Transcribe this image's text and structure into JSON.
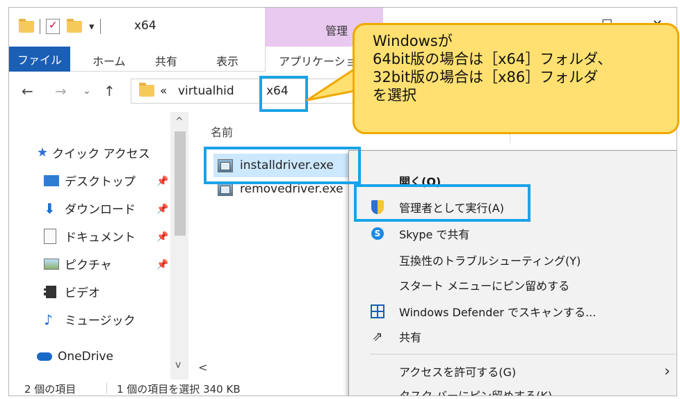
{
  "window": {
    "title": "x64",
    "manage_tab": "管理",
    "maximize_glyph": "☐",
    "close_glyph": "✕"
  },
  "ribbon": {
    "file": "ファイル",
    "home": "ホーム",
    "share": "共有",
    "view": "表示",
    "app_tools": "アプリケーション"
  },
  "address": {
    "prefix": "«",
    "segment1": "virtualhid",
    "segment2": "x64"
  },
  "nav": {
    "quick_access": "クイック アクセス",
    "items": [
      {
        "label": "デスクトップ",
        "icon": "desktop-icon"
      },
      {
        "label": "ダウンロード",
        "icon": "download-icon"
      },
      {
        "label": "ドキュメント",
        "icon": "document-icon"
      },
      {
        "label": "ピクチャ",
        "icon": "picture-icon"
      },
      {
        "label": "ビデオ",
        "icon": "video-icon"
      },
      {
        "label": "ミュージック",
        "icon": "music-icon"
      },
      {
        "label": "OneDrive",
        "icon": "cloud-icon"
      }
    ]
  },
  "files": {
    "column_name": "名前",
    "rows": [
      {
        "name": "installdriver.exe",
        "selected": true
      },
      {
        "name": "removedriver.exe",
        "selected": false
      }
    ]
  },
  "status": {
    "count": "2 個の項目",
    "selection": "1 個の項目を選択 340 KB"
  },
  "context_menu": {
    "items": [
      {
        "label": "開く(O)"
      },
      {
        "label": "管理者として実行(A)",
        "icon": "uac-shield-icon"
      },
      {
        "label": "Skype で共有",
        "icon": "skype-icon"
      },
      {
        "label": "互換性のトラブルシューティング(Y)"
      },
      {
        "label": "スタート メニューにピン留めする"
      },
      {
        "label": "Windows Defender でスキャンする...",
        "icon": "defender-icon"
      },
      {
        "label": "共有",
        "icon": "share-icon"
      },
      {
        "label": "アクセスを許可する(G)",
        "submenu": true
      },
      {
        "label": "タスク バーにピン留めする(K)"
      }
    ]
  },
  "callout": {
    "line1": "Windowsが",
    "line2": "64bit版の場合は［x64］フォルダ、",
    "line3": "32bit版の場合は［x86］フォルダ",
    "line4": "を選択"
  },
  "colors": {
    "highlight": "#1aa3e8",
    "callout_fill": "#ffe070",
    "callout_border": "#f0a800",
    "file_tab": "#1a5fb4",
    "manage_tab": "#e9c9f0",
    "selection": "#cce8ff"
  }
}
